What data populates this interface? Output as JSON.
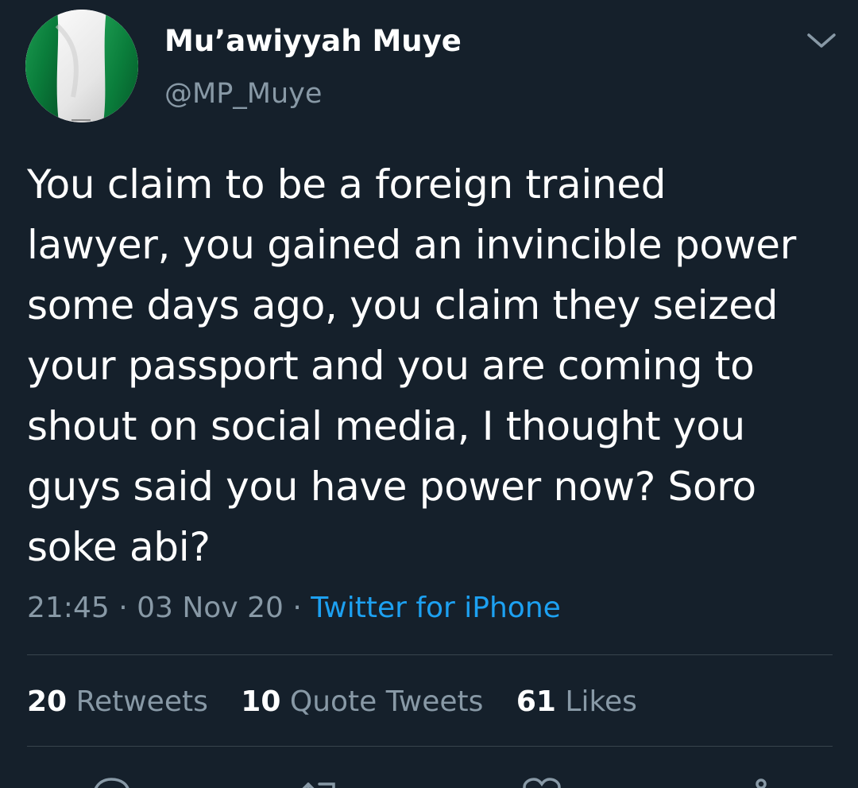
{
  "author": {
    "display_name": "Mu’awiyyah Muye",
    "handle": "@MP_Muye",
    "avatar_icon": "nigeria-flag-avatar"
  },
  "tweet": {
    "text": "You claim to be a foreign trained\nlawyer, you gained an invincible power\nsome days ago, you claim they seized\nyour passport and you are coming to\nshout on social media, I thought you\nguys said you have power now? Soro\nsoke abi?",
    "time": "21:45",
    "date": "03 Nov 20",
    "separator": "·",
    "source": "Twitter for iPhone"
  },
  "stats": [
    {
      "count": "20",
      "label": "Retweets"
    },
    {
      "count": "10",
      "label": "Quote Tweets"
    },
    {
      "count": "61",
      "label": "Likes"
    }
  ],
  "icons": {
    "more": "chevron-down-icon",
    "reply": "reply-icon",
    "retweet": "retweet-icon",
    "like": "heart-icon",
    "share": "share-icon"
  },
  "colors": {
    "background": "#15202b",
    "secondary_text": "#8899a6",
    "link": "#1da1f2",
    "divider": "#38444d",
    "flag_green": "#0a7d3b"
  }
}
